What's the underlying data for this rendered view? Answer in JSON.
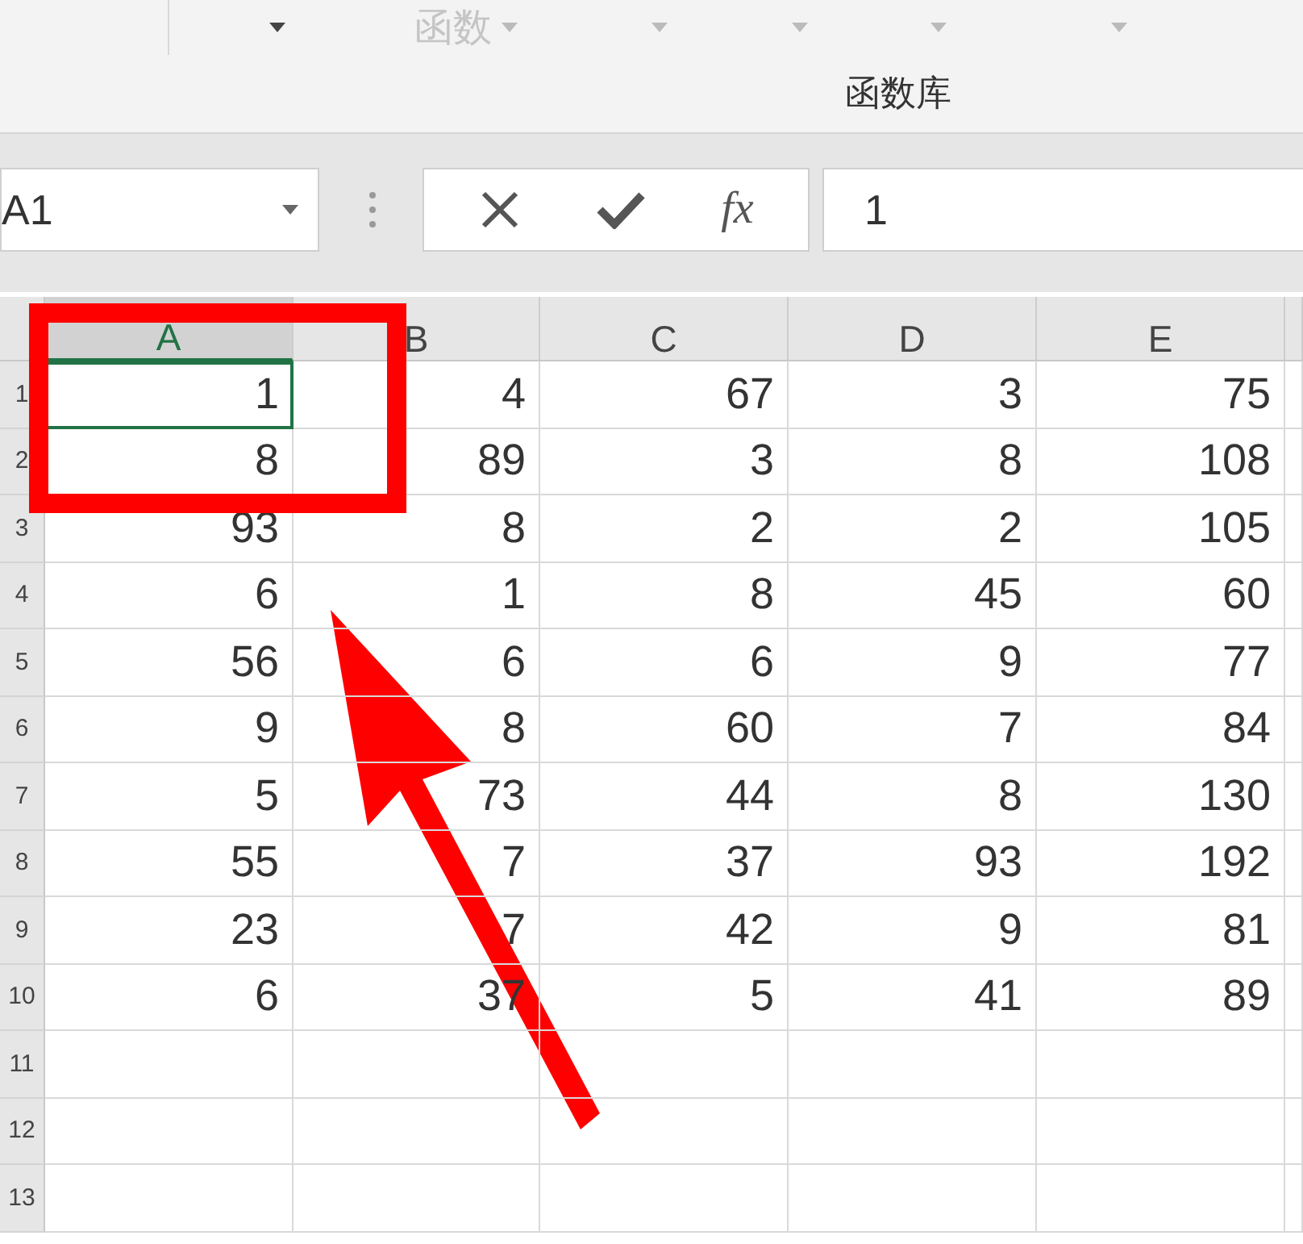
{
  "ribbon": {
    "buttons": [
      {
        "kind": "caret"
      },
      {
        "kind": "labeled",
        "label": "函数",
        "disabled": true
      },
      {
        "kind": "caret"
      },
      {
        "kind": "caret"
      },
      {
        "kind": "caret"
      },
      {
        "kind": "caret"
      }
    ],
    "group_label": "函数库"
  },
  "formula_bar": {
    "name_box": "A1",
    "buttons": [
      {
        "kind": "cancel"
      },
      {
        "kind": "enter"
      },
      {
        "kind": "function",
        "label": "fx"
      }
    ],
    "value": "1"
  },
  "sheet": {
    "columns": [
      "A",
      "B",
      "C",
      "D",
      "E"
    ],
    "rows": [
      {
        "header": "1",
        "cells": [
          {
            "value": "1",
            "selected": true
          },
          {
            "value": "4",
            "selected": false
          },
          {
            "value": "67",
            "selected": false
          },
          {
            "value": "3",
            "selected": false
          },
          {
            "value": "75",
            "selected": false
          }
        ]
      },
      {
        "header": "2",
        "cells": [
          {
            "value": "8",
            "selected": false
          },
          {
            "value": "89",
            "selected": false
          },
          {
            "value": "3",
            "selected": false
          },
          {
            "value": "8",
            "selected": false
          },
          {
            "value": "108",
            "selected": false
          }
        ]
      },
      {
        "header": "3",
        "cells": [
          {
            "value": "93",
            "selected": false
          },
          {
            "value": "8",
            "selected": false
          },
          {
            "value": "2",
            "selected": false
          },
          {
            "value": "2",
            "selected": false
          },
          {
            "value": "105",
            "selected": false
          }
        ]
      },
      {
        "header": "4",
        "cells": [
          {
            "value": "6",
            "selected": false
          },
          {
            "value": "1",
            "selected": false
          },
          {
            "value": "8",
            "selected": false
          },
          {
            "value": "45",
            "selected": false
          },
          {
            "value": "60",
            "selected": false
          }
        ]
      },
      {
        "header": "5",
        "cells": [
          {
            "value": "56",
            "selected": false
          },
          {
            "value": "6",
            "selected": false
          },
          {
            "value": "6",
            "selected": false
          },
          {
            "value": "9",
            "selected": false
          },
          {
            "value": "77",
            "selected": false
          }
        ]
      },
      {
        "header": "6",
        "cells": [
          {
            "value": "9",
            "selected": false
          },
          {
            "value": "8",
            "selected": false
          },
          {
            "value": "60",
            "selected": false
          },
          {
            "value": "7",
            "selected": false
          },
          {
            "value": "84",
            "selected": false
          }
        ]
      },
      {
        "header": "7",
        "cells": [
          {
            "value": "5",
            "selected": false
          },
          {
            "value": "73",
            "selected": false
          },
          {
            "value": "44",
            "selected": false
          },
          {
            "value": "8",
            "selected": false
          },
          {
            "value": "130",
            "selected": false
          }
        ]
      },
      {
        "header": "8",
        "cells": [
          {
            "value": "55",
            "selected": false
          },
          {
            "value": "7",
            "selected": false
          },
          {
            "value": "37",
            "selected": false
          },
          {
            "value": "93",
            "selected": false
          },
          {
            "value": "192",
            "selected": false
          }
        ]
      },
      {
        "header": "9",
        "cells": [
          {
            "value": "23",
            "selected": false
          },
          {
            "value": "7",
            "selected": false
          },
          {
            "value": "42",
            "selected": false
          },
          {
            "value": "9",
            "selected": false
          },
          {
            "value": "81",
            "selected": false
          }
        ]
      },
      {
        "header": "10",
        "cells": [
          {
            "value": "6",
            "selected": false
          },
          {
            "value": "37",
            "selected": false
          },
          {
            "value": "5",
            "selected": false
          },
          {
            "value": "41",
            "selected": false
          },
          {
            "value": "89",
            "selected": false
          }
        ]
      },
      {
        "header": "11"
      },
      {
        "header": "12"
      },
      {
        "header": "13"
      }
    ]
  },
  "annotations": [
    {
      "kind": "box"
    },
    {
      "kind": "arrow"
    }
  ]
}
